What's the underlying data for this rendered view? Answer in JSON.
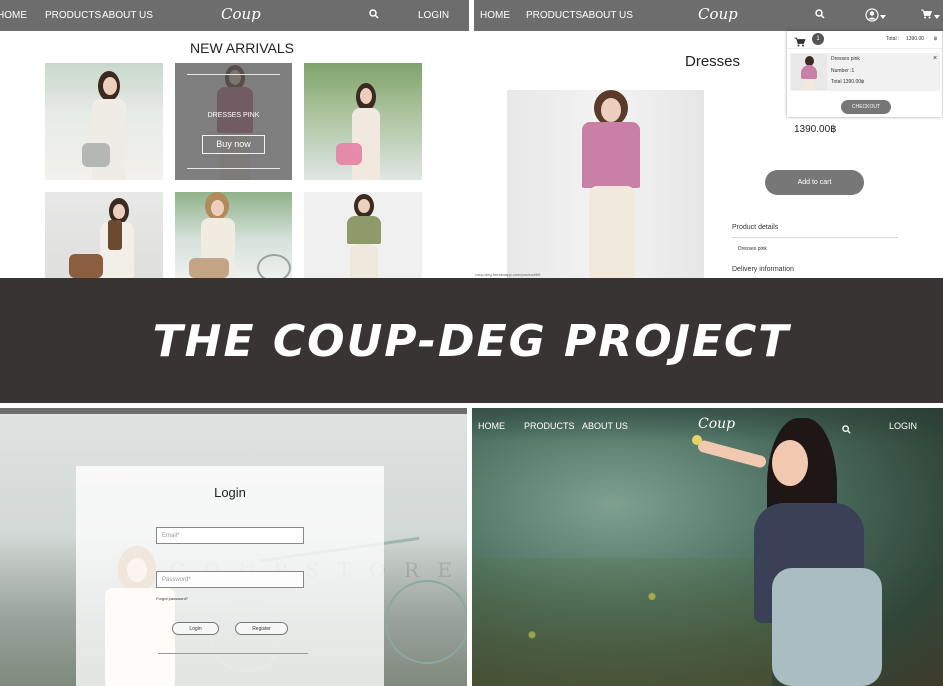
{
  "banner": {
    "title": "THE COUP-DEG PROJECT"
  },
  "shop_nav": {
    "home": "HOME",
    "products": "PRODUCTS",
    "about": "ABOUT US",
    "logo": "Coup",
    "login": "LOGIN"
  },
  "new_arrivals": {
    "heading": "NEW ARRIVALS",
    "hover_product_name": "DRESSES PINK",
    "buy_label": "Buy now"
  },
  "product_page": {
    "title": "Dresses",
    "price": "1390.00฿",
    "add_to_cart": "Add to cart",
    "details_heading": "Product details",
    "details_text": "Dresses pink",
    "delivery_heading": "Delivery information",
    "status_url": "coup-deg.herokuapp.com/product/69"
  },
  "cart_popup": {
    "count": "1",
    "total_label": "Total :",
    "total_value": "1390.00",
    "currency": "฿",
    "item_name": "Dresses pink",
    "item_number": "Number :1",
    "item_total": "Total 1390.00฿",
    "close": "×",
    "checkout": "CHECKOUT"
  },
  "login_page": {
    "heading": "Login",
    "email_placeholder": "Email*",
    "password_placeholder": "Password*",
    "forgot": "Forgot password?",
    "login_button": "Login",
    "register_button": "Register",
    "background_sign": "C O U P   S T O R E"
  },
  "colors": {
    "nav_bg": "#6d6d6d",
    "banner_bg": "#383433",
    "accent_pink": "#c47a98",
    "button_grey": "#777777"
  },
  "icons": [
    "search-icon",
    "user-icon",
    "cart-icon",
    "chevron-down-icon",
    "close-icon"
  ]
}
